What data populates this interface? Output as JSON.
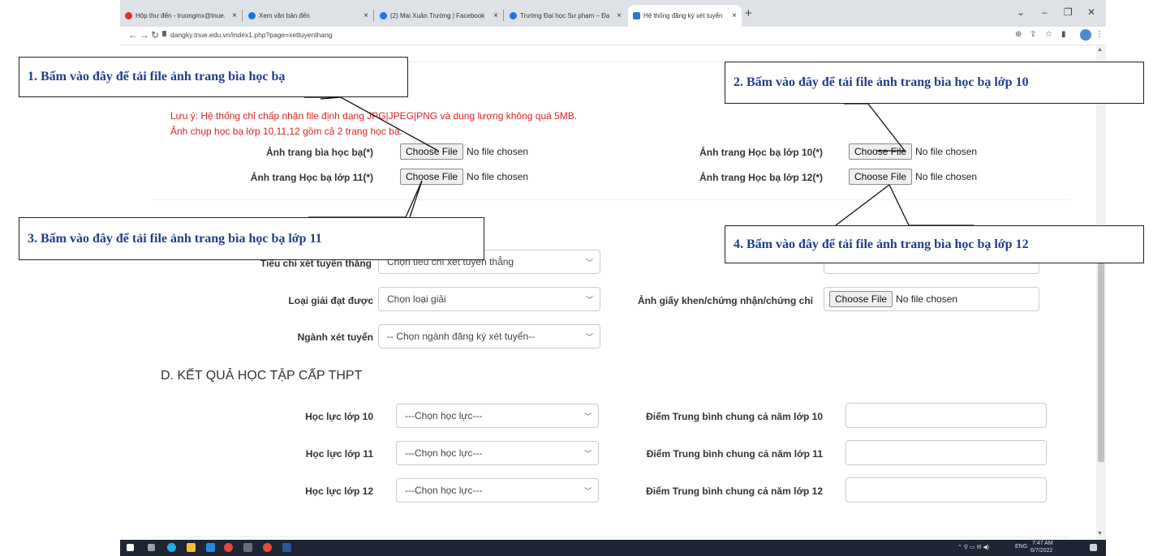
{
  "browser": {
    "tabs": [
      {
        "label": "Hộp thư đến - truongmx@tnue.edu.vn",
        "favicon_color": "#d93025"
      },
      {
        "label": "Xem văn bản đến",
        "favicon_color": "#1a73e8"
      },
      {
        "label": "(2) Mai Xuân Trường | Facebook",
        "favicon_color": "#1877f2"
      },
      {
        "label": "Trường Đại học Sư phạm – Đại học Thái Nguyên",
        "favicon_color": "#1a73e8"
      },
      {
        "label": "Hệ thống đăng ký xét tuyển trực tuyến",
        "favicon_color": "#2a7ad6"
      }
    ],
    "url": "dangky.tnue.edu.vn/index1.php?page=xettuyenthang"
  },
  "upload": {
    "note_line1": "Lưu ý: Hệ thống chỉ chấp nhận file định dạng JPG|JPEG|PNG và dung lượng không quá 5MB.",
    "note_line2": "Ảnh chụp học bạ lớp 10,11,12 gồm cả 2 trang học bạ.",
    "choose_label": "Choose File",
    "no_file": "No file chosen",
    "fields": {
      "cover": "Ảnh trang bìa học bạ(*)",
      "grade10": "Ảnh trang Học bạ lớp 10(*)",
      "grade11": "Ảnh trang Học bạ lớp 11(*)",
      "grade12": "Ảnh trang Học bạ lớp 12(*)"
    }
  },
  "criteria": {
    "criteria_label": "Tiêu chí xét tuyển thẳng",
    "criteria_select": "Chọn tiêu chí xét tuyển thẳng",
    "award_label": "Loại giải đạt được",
    "award_select": "Chọn loại giải",
    "certificate_label": "Ảnh giấy khen/chứng nhận/chứng chỉ",
    "major_label": "Ngành xét tuyển",
    "major_select": "-- Chọn ngành đăng ký xét tuyển--"
  },
  "results": {
    "title": "D. KẾT QUẢ HỌC TẬP CẤP THPT",
    "rows": [
      {
        "label": "Học lực lớp 10",
        "select": "---Chọn học lực---",
        "gpa_label": "Điểm Trung bình chung cả năm lớp 10"
      },
      {
        "label": "Học lực lớp 11",
        "select": "---Chọn học lực---",
        "gpa_label": "Điểm Trung bình chung cả năm lớp 11"
      },
      {
        "label": "Học lực lớp 12",
        "select": "---Chọn học lực---",
        "gpa_label": "Điểm Trung bình chung cả năm lớp 12"
      }
    ]
  },
  "callouts": {
    "c1": "1. Bấm vào đây để tải file ảnh trang bìa học bạ",
    "c2": "2. Bấm vào đây để tải file ảnh trang bìa học bạ lớp 10",
    "c3": "3. Bấm vào đây để tải file ảnh trang bìa học bạ lớp 11",
    "c4": "4. Bấm vào đây để tải file ảnh trang bìa học bạ lớp 12"
  },
  "taskbar": {
    "time": "7:47 AM",
    "date": "6/7/2022",
    "lang": "ENG"
  }
}
